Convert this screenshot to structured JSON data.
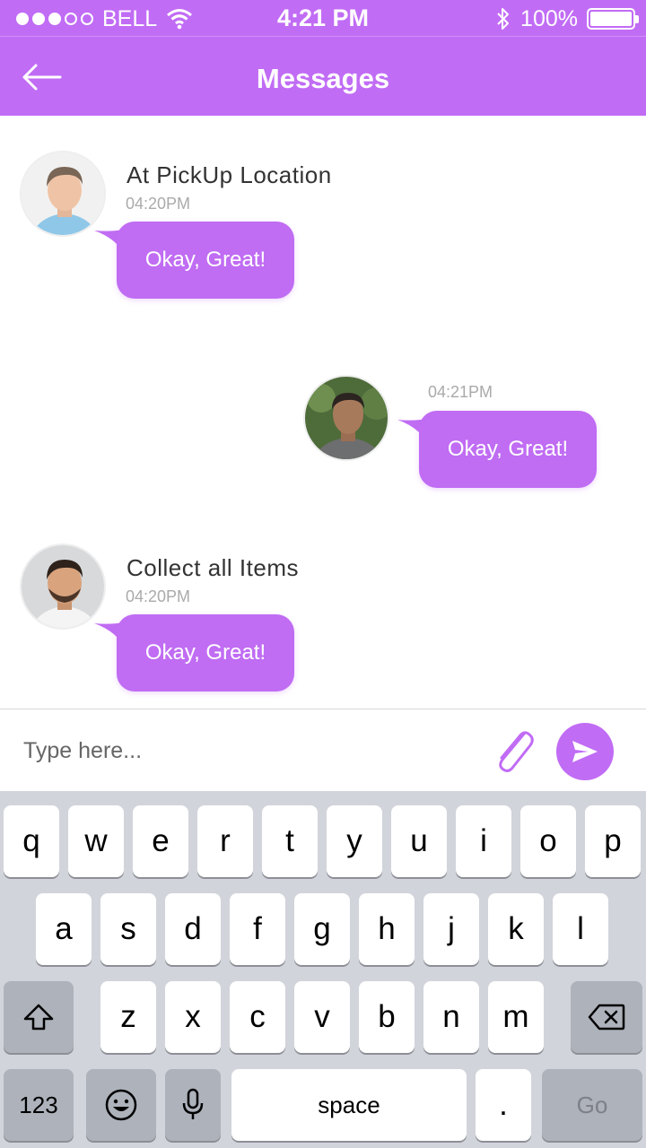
{
  "status_bar": {
    "carrier": "BELL",
    "time": "4:21 PM",
    "battery": "100%",
    "signal_bars_filled": 3,
    "signal_bars_total": 5
  },
  "header": {
    "title": "Messages",
    "back_icon": "arrow-left-icon"
  },
  "messages": [
    {
      "sender": "At PickUp Location",
      "time": "04:20PM",
      "text": "Okay, Great!",
      "side": "left"
    },
    {
      "sender": "",
      "time": "04:21PM",
      "text": "Okay, Great!",
      "side": "right"
    },
    {
      "sender": "Collect all Items",
      "time": "04:20PM",
      "text": "Okay, Great!",
      "side": "left"
    }
  ],
  "composer": {
    "placeholder": "Type here...",
    "attach_icon": "paperclip-icon",
    "send_icon": "send-icon"
  },
  "keyboard": {
    "row1": [
      "q",
      "w",
      "e",
      "r",
      "t",
      "y",
      "u",
      "i",
      "o",
      "p"
    ],
    "row2": [
      "a",
      "s",
      "d",
      "f",
      "g",
      "h",
      "j",
      "k",
      "l"
    ],
    "row3": [
      "z",
      "x",
      "c",
      "v",
      "b",
      "n",
      "m"
    ],
    "numbers": "123",
    "space": "space",
    "period": ".",
    "go": "Go"
  },
  "colors": {
    "accent": "#c16cf5",
    "bubble": "#c06cf3",
    "keyboard_bg": "#d1d4da"
  }
}
